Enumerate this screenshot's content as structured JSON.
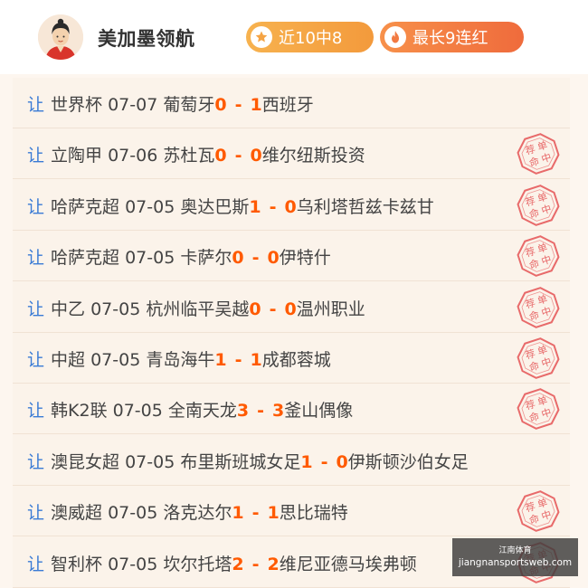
{
  "header": {
    "name": "美加墨领航",
    "badge_recent": "近10中8",
    "badge_streak": "最长9连红"
  },
  "colors": {
    "rang": "#3a7bd5",
    "score": "#ff5a00",
    "stamp": "#e86a6a",
    "badge_recent": "#f5a444",
    "badge_streak": "#f27a42"
  },
  "rows": [
    {
      "rang": "让",
      "league": "世界杯",
      "date": "07-07",
      "home": "葡萄牙",
      "home_score": "0",
      "sep": "-",
      "away_score": "1",
      "away": "西班牙",
      "stamp": ""
    },
    {
      "rang": "让",
      "league": "立陶甲",
      "date": "07-06",
      "home": "苏杜瓦",
      "home_score": "0",
      "sep": "-",
      "away_score": "0",
      "away": "维尔纽斯投资",
      "stamp": "荐单命中"
    },
    {
      "rang": "让",
      "league": "哈萨克超",
      "date": "07-05",
      "home": "奥达巴斯",
      "home_score": "1",
      "sep": "-",
      "away_score": "0",
      "away": "乌利塔哲兹卡兹甘",
      "stamp": "荐单命中"
    },
    {
      "rang": "让",
      "league": "哈萨克超",
      "date": "07-05",
      "home": "卡萨尔",
      "home_score": "0",
      "sep": "-",
      "away_score": "0",
      "away": "伊特什",
      "stamp": "荐单命中"
    },
    {
      "rang": "让",
      "league": "中乙",
      "date": "07-05",
      "home": "杭州临平吴越",
      "home_score": "0",
      "sep": "-",
      "away_score": "0",
      "away": "温州职业",
      "stamp": "荐单命中"
    },
    {
      "rang": "让",
      "league": "中超",
      "date": "07-05",
      "home": "青岛海牛",
      "home_score": "1",
      "sep": "-",
      "away_score": "1",
      "away": "成都蓉城",
      "stamp": "荐单命中"
    },
    {
      "rang": "让",
      "league": "韩K2联",
      "date": "07-05",
      "home": "全南天龙",
      "home_score": "3",
      "sep": "-",
      "away_score": "3",
      "away": "釜山偶像",
      "stamp": "荐单命中"
    },
    {
      "rang": "让",
      "league": "澳昆女超",
      "date": "07-05",
      "home": "布里斯班城女足",
      "home_score": "1",
      "sep": "-",
      "away_score": "0",
      "away": "伊斯顿沙伯女足",
      "stamp": ""
    },
    {
      "rang": "让",
      "league": "澳威超",
      "date": "07-05",
      "home": "洛克达尔",
      "home_score": "1",
      "sep": "-",
      "away_score": "1",
      "away": "思比瑞特",
      "stamp": "荐单命中"
    },
    {
      "rang": "让",
      "league": "智利杯",
      "date": "07-05",
      "home": "坎尔托塔",
      "home_score": "2",
      "sep": "-",
      "away_score": "2",
      "away": "维尼亚德马埃弗顿",
      "stamp": "荐单命中"
    }
  ],
  "watermark": {
    "line1": "江南体育",
    "line2": "jiangnansportsweb.com"
  }
}
